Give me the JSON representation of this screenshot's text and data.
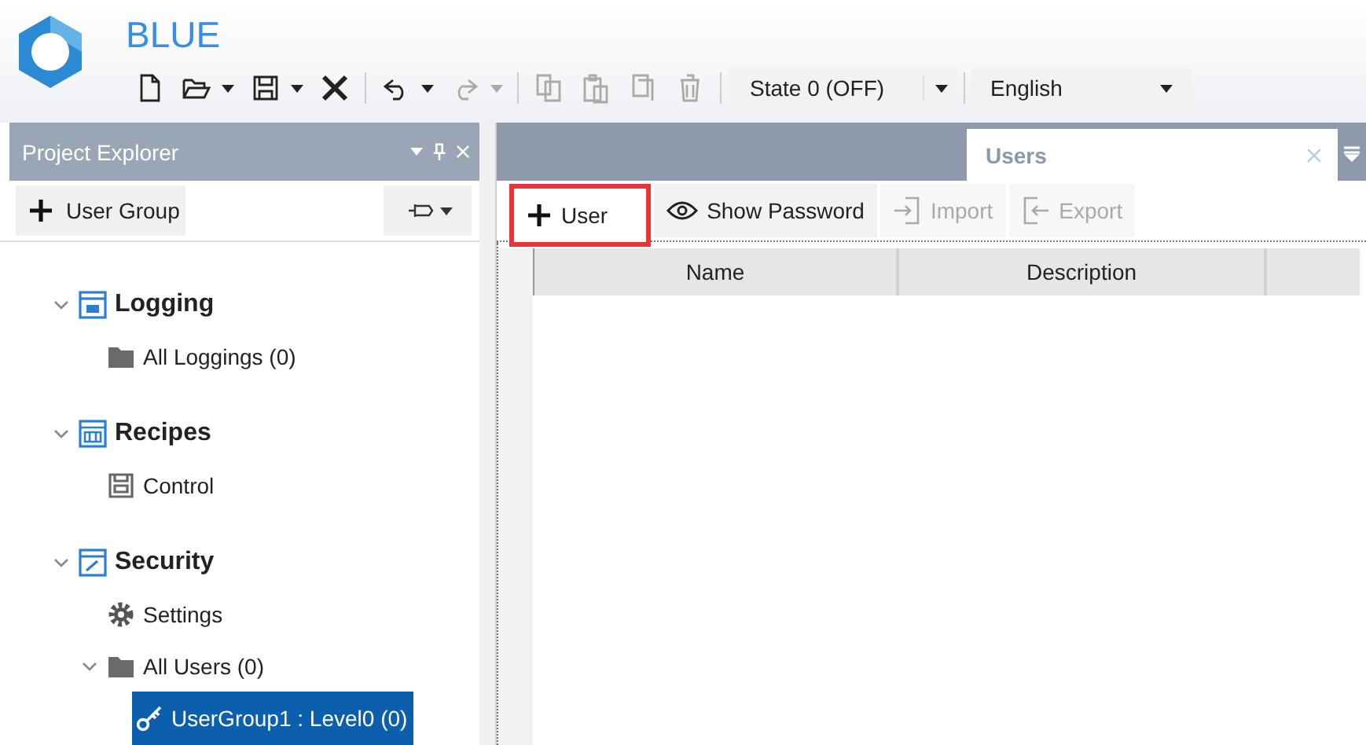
{
  "app": {
    "name": "BLUE"
  },
  "toolbar": [
    {
      "kind": "new",
      "disabled": false,
      "dropdown": false
    },
    {
      "kind": "open",
      "disabled": false,
      "dropdown": true
    },
    {
      "kind": "save",
      "disabled": false,
      "dropdown": true
    },
    {
      "kind": "close",
      "disabled": false,
      "dropdown": false
    },
    {
      "kind": "undo",
      "disabled": false,
      "dropdown": true
    },
    {
      "kind": "redo",
      "disabled": true,
      "dropdown": true
    },
    {
      "kind": "copy",
      "disabled": true,
      "dropdown": false
    },
    {
      "kind": "paste",
      "disabled": true,
      "dropdown": false
    },
    {
      "kind": "duplicate",
      "disabled": true,
      "dropdown": false
    },
    {
      "kind": "delete",
      "disabled": true,
      "dropdown": false
    }
  ],
  "state_select": {
    "value": "State 0 (OFF)"
  },
  "language_select": {
    "value": "English"
  },
  "explorer": {
    "title": "Project Explorer",
    "add_button": "User Group",
    "tree": [
      {
        "label": "Logging",
        "kind": "logging",
        "expanded": true,
        "selected": false,
        "children": [
          {
            "label": "All Loggings (0)",
            "kind": "folder",
            "selected": false
          }
        ]
      },
      {
        "label": "Recipes",
        "kind": "recipes",
        "expanded": true,
        "selected": false,
        "children": [
          {
            "label": "Control",
            "kind": "control",
            "selected": false
          }
        ]
      },
      {
        "label": "Security",
        "kind": "security",
        "expanded": true,
        "selected": false,
        "children": [
          {
            "label": "Settings",
            "kind": "settings",
            "selected": false
          },
          {
            "label": "All Users (0)",
            "kind": "folder",
            "expanded": true,
            "selected": false,
            "children": [
              {
                "label": "UserGroup1 : Level0 (0)",
                "kind": "key",
                "selected": true
              }
            ]
          }
        ]
      }
    ]
  },
  "tabs": [
    {
      "label": "Users",
      "selected": true
    }
  ],
  "users_toolbar": [
    {
      "label": "User",
      "kind": "add",
      "disabled": false,
      "highlighted": true
    },
    {
      "label": "Show Password",
      "kind": "eye",
      "disabled": false,
      "highlighted": false
    },
    {
      "label": "Import",
      "kind": "import",
      "disabled": true,
      "highlighted": false
    },
    {
      "label": "Export",
      "kind": "export",
      "disabled": true,
      "highlighted": false
    }
  ],
  "table": {
    "columns": [
      "Name",
      "Description"
    ]
  }
}
